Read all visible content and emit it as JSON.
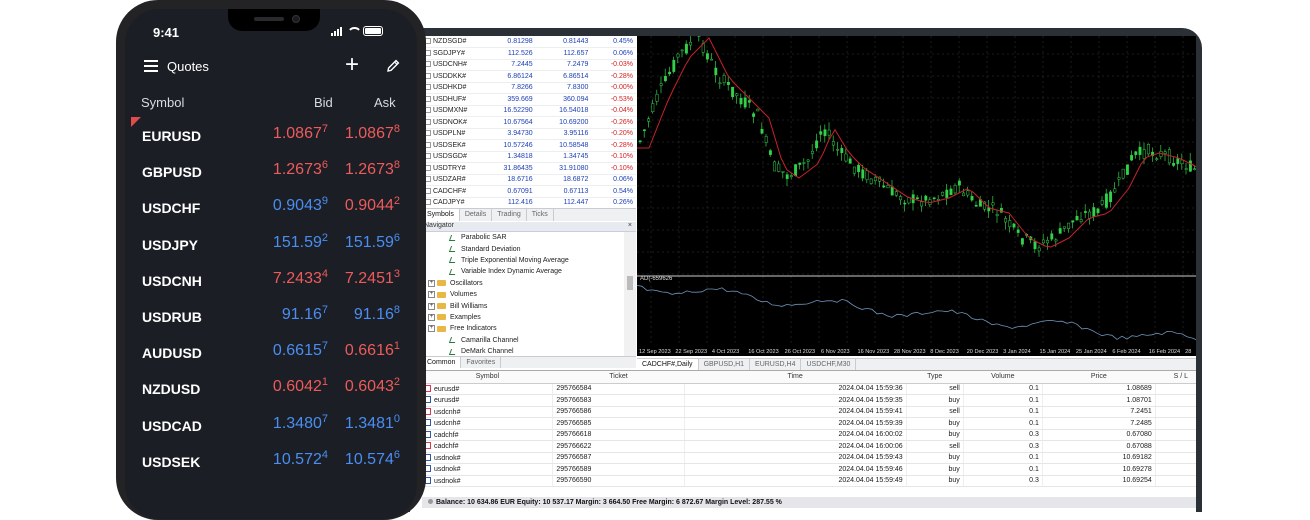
{
  "phone": {
    "status_time": "9:41",
    "title": "Quotes",
    "columns": {
      "symbol": "Symbol",
      "bid": "Bid",
      "ask": "Ask"
    },
    "quotes": [
      {
        "symbol": "EURUSD",
        "bid_main": "1.086",
        "bid_big": "7",
        "bid_sup": "7",
        "ask_main": "1.086",
        "ask_big": "7",
        "ask_sup": "8",
        "bid_dir": "dn",
        "ask_dir": "dn"
      },
      {
        "symbol": "GBPUSD",
        "bid_main": "1.267",
        "bid_big": "3",
        "bid_sup": "6",
        "ask_main": "1.267",
        "ask_big": "3",
        "ask_sup": "8",
        "bid_dir": "dn",
        "ask_dir": "dn"
      },
      {
        "symbol": "USDCHF",
        "bid_main": "0.904",
        "bid_big": "3",
        "bid_sup": "9",
        "ask_main": "0.904",
        "ask_big": "4",
        "ask_sup": "2",
        "bid_dir": "up",
        "ask_dir": "dn"
      },
      {
        "symbol": "USDJPY",
        "bid_main": "151.5",
        "bid_big": "9",
        "bid_sup": "2",
        "ask_main": "151.5",
        "ask_big": "9",
        "ask_sup": "6",
        "bid_dir": "up",
        "ask_dir": "up"
      },
      {
        "symbol": "USDCNH",
        "bid_main": "7.243",
        "bid_big": "3",
        "bid_sup": "4",
        "ask_main": "7.245",
        "ask_big": "1",
        "ask_sup": "3",
        "bid_dir": "dn",
        "ask_dir": "dn"
      },
      {
        "symbol": "USDRUB",
        "bid_main": "91.1",
        "bid_big": "6",
        "bid_sup": "7",
        "ask_main": "91.1",
        "ask_big": "6",
        "ask_sup": "8",
        "bid_dir": "up",
        "ask_dir": "up"
      },
      {
        "symbol": "AUDUSD",
        "bid_main": "0.661",
        "bid_big": "5",
        "bid_sup": "7",
        "ask_main": "0.661",
        "ask_big": "6",
        "ask_sup": "1",
        "bid_dir": "up",
        "ask_dir": "dn"
      },
      {
        "symbol": "NZDUSD",
        "bid_main": "0.604",
        "bid_big": "2",
        "bid_sup": "1",
        "ask_main": "0.604",
        "ask_big": "3",
        "ask_sup": "2",
        "bid_dir": "dn",
        "ask_dir": "dn"
      },
      {
        "symbol": "USDCAD",
        "bid_main": "1.348",
        "bid_big": "0",
        "bid_sup": "7",
        "ask_main": "1.348",
        "ask_big": "1",
        "ask_sup": "0",
        "bid_dir": "up",
        "ask_dir": "up"
      },
      {
        "symbol": "USDSEK",
        "bid_main": "10.57",
        "bid_big": "2",
        "bid_sup": "4",
        "ask_main": "10.57",
        "ask_big": "4",
        "ask_sup": "6",
        "bid_dir": "up",
        "ask_dir": "up"
      }
    ]
  },
  "market_watch": {
    "rows": [
      {
        "symbol": "NZDSGD#",
        "bid": "0.81298",
        "ask": "0.81443",
        "change": "0.45%",
        "dir": "pos"
      },
      {
        "symbol": "SGDJPY#",
        "bid": "112.526",
        "ask": "112.657",
        "change": "0.06%",
        "dir": "pos"
      },
      {
        "symbol": "USDCNH#",
        "bid": "7.2445",
        "ask": "7.2479",
        "change": "-0.03%",
        "dir": "neg"
      },
      {
        "symbol": "USDDKK#",
        "bid": "6.86124",
        "ask": "6.86514",
        "change": "-0.28%",
        "dir": "neg"
      },
      {
        "symbol": "USDHKD#",
        "bid": "7.8266",
        "ask": "7.8300",
        "change": "-0.00%",
        "dir": "neg"
      },
      {
        "symbol": "USDHUF#",
        "bid": "359.669",
        "ask": "360.094",
        "change": "-0.53%",
        "dir": "neg"
      },
      {
        "symbol": "USDMXN#",
        "bid": "16.52290",
        "ask": "16.54018",
        "change": "-0.04%",
        "dir": "neg"
      },
      {
        "symbol": "USDNOK#",
        "bid": "10.67564",
        "ask": "10.69200",
        "change": "-0.26%",
        "dir": "neg"
      },
      {
        "symbol": "USDPLN#",
        "bid": "3.94730",
        "ask": "3.95116",
        "change": "-0.20%",
        "dir": "neg"
      },
      {
        "symbol": "USDSEK#",
        "bid": "10.57246",
        "ask": "10.58548",
        "change": "-0.28%",
        "dir": "neg"
      },
      {
        "symbol": "USDSGD#",
        "bid": "1.34818",
        "ask": "1.34745",
        "change": "-0.10%",
        "dir": "neg"
      },
      {
        "symbol": "USDTRY#",
        "bid": "31.86435",
        "ask": "31.91080",
        "change": "-0.10%",
        "dir": "neg"
      },
      {
        "symbol": "USDZAR#",
        "bid": "18.6716",
        "ask": "18.6872",
        "change": "0.06%",
        "dir": "pos"
      },
      {
        "symbol": "CADCHF#",
        "bid": "0.67091",
        "ask": "0.67113",
        "change": "0.54%",
        "dir": "pos"
      },
      {
        "symbol": "CADJPY#",
        "bid": "112.416",
        "ask": "112.447",
        "change": "0.26%",
        "dir": "pos"
      }
    ],
    "tabs": [
      "Symbols",
      "Details",
      "Trading",
      "Ticks"
    ]
  },
  "navigator": {
    "header": "Navigator",
    "items": [
      {
        "label": "Parabolic SAR",
        "kind": "indicator"
      },
      {
        "label": "Standard Deviation",
        "kind": "indicator"
      },
      {
        "label": "Triple Exponential Moving Average",
        "kind": "indicator"
      },
      {
        "label": "Variable Index Dynamic Average",
        "kind": "indicator"
      },
      {
        "label": "Oscillators",
        "kind": "folder"
      },
      {
        "label": "Volumes",
        "kind": "folder"
      },
      {
        "label": "Bill Williams",
        "kind": "folder"
      },
      {
        "label": "Examples",
        "kind": "folder"
      },
      {
        "label": "Free Indicators",
        "kind": "folder"
      },
      {
        "label": "Camarilla Channel",
        "kind": "indicator"
      },
      {
        "label": "DeMark Channel",
        "kind": "indicator"
      }
    ],
    "tabs": [
      "Common",
      "Favorites"
    ]
  },
  "chart": {
    "indicator_label": "AD(-659626",
    "x_labels": [
      "12 Sep 2023",
      "22 Sep 2023",
      "4 Oct 2023",
      "16 Oct 2023",
      "26 Oct 2023",
      "6 Nov 2023",
      "16 Nov 2023",
      "28 Nov 2023",
      "8 Dec 2023",
      "20 Dec 2023",
      "3 Jan 2024",
      "15 Jan 2024",
      "25 Jan 2024",
      "6 Feb 2024",
      "16 Feb 2024",
      "28"
    ],
    "tabs": [
      "CADCHF#,Daily",
      "GBPUSD,H1",
      "EURUSD,H4",
      "USDCHF,M30"
    ],
    "colors": {
      "bull": "#32d14a",
      "line": "#c8222a",
      "indicator": "#6e93b8",
      "grid": "#3a3a3a"
    }
  },
  "trade": {
    "columns": [
      "Symbol",
      "Ticket",
      "Time",
      "Type",
      "Volume",
      "Price",
      "S / L"
    ],
    "rows": [
      {
        "symbol": "eurusd#",
        "ticket": "295766584",
        "time": "2024.04.04 15:59:36",
        "type": "sell",
        "volume": "0.1",
        "price": "1.08689"
      },
      {
        "symbol": "eurusd#",
        "ticket": "295766583",
        "time": "2024.04.04 15:59:35",
        "type": "buy",
        "volume": "0.1",
        "price": "1.08701"
      },
      {
        "symbol": "usdcnh#",
        "ticket": "295766586",
        "time": "2024.04.04 15:59:41",
        "type": "sell",
        "volume": "0.1",
        "price": "7.2451"
      },
      {
        "symbol": "usdcnh#",
        "ticket": "295766585",
        "time": "2024.04.04 15:59:39",
        "type": "buy",
        "volume": "0.1",
        "price": "7.2485"
      },
      {
        "symbol": "cadchf#",
        "ticket": "295766618",
        "time": "2024.04.04 16:00:02",
        "type": "buy",
        "volume": "0.3",
        "price": "0.67080"
      },
      {
        "symbol": "cadchf#",
        "ticket": "295766622",
        "time": "2024.04.04 16:00:06",
        "type": "sell",
        "volume": "0.3",
        "price": "0.67088"
      },
      {
        "symbol": "usdnok#",
        "ticket": "295766587",
        "time": "2024.04.04 15:59:43",
        "type": "buy",
        "volume": "0.1",
        "price": "10.69182"
      },
      {
        "symbol": "usdnok#",
        "ticket": "295766589",
        "time": "2024.04.04 15:59:46",
        "type": "buy",
        "volume": "0.1",
        "price": "10.69278"
      },
      {
        "symbol": "usdnok#",
        "ticket": "295766590",
        "time": "2024.04.04 15:59:49",
        "type": "buy",
        "volume": "0.3",
        "price": "10.69254"
      }
    ],
    "balance": "Balance: 10 634.86 EUR  Equity: 10 537.17  Margin: 3 664.50  Free Margin: 6 872.67  Margin Level: 287.55 %"
  }
}
